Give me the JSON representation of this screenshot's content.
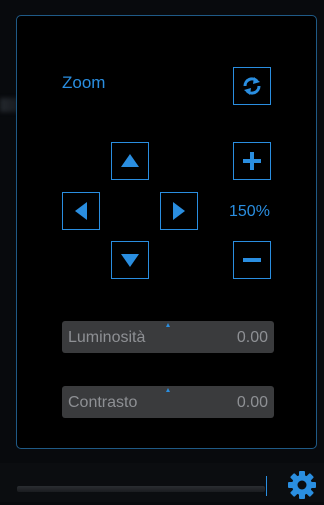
{
  "zoom": {
    "label": "Zoom",
    "value_text": "150%"
  },
  "sliders": {
    "brightness": {
      "label": "Luminosità",
      "value_text": "0.00",
      "value": 0.0
    },
    "contrast": {
      "label": "Contrasto",
      "value_text": "0.00",
      "value": 0.0
    }
  },
  "icons": {
    "reset": "refresh-icon",
    "up": "arrow-up-icon",
    "down": "arrow-down-icon",
    "left": "arrow-left-icon",
    "right": "arrow-right-icon",
    "plus": "plus-icon",
    "minus": "minus-icon",
    "settings": "gear-icon"
  },
  "colors": {
    "accent": "#2a8ee0",
    "panel_border": "#1f5a86",
    "slider_bg": "#3a3b3d",
    "slider_text": "#8e9094"
  }
}
